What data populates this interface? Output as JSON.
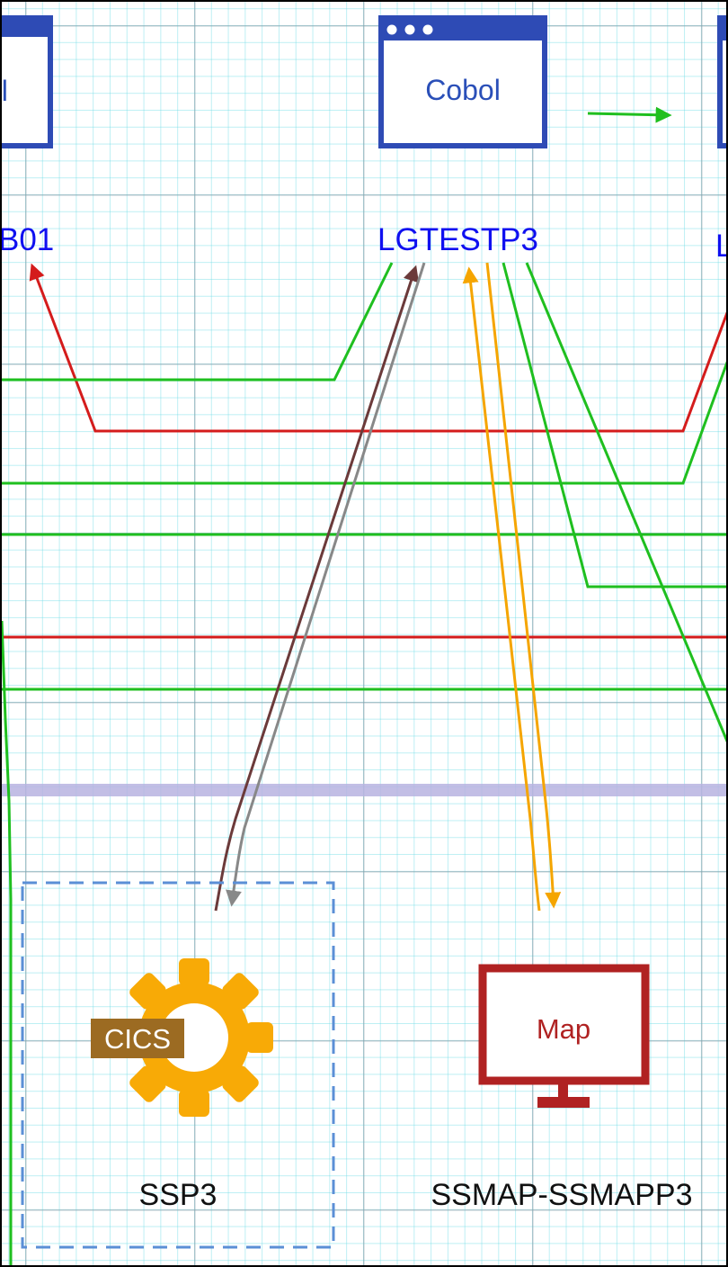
{
  "windows": {
    "left_partial_title": "ol",
    "center_title": "Cobol"
  },
  "programs": {
    "left_partial": "B01",
    "center": "LGTESTP3",
    "right_partial": "L"
  },
  "nodes": {
    "cics_badge": "CICS",
    "cics_name": "SSP3",
    "map_screen": "Map",
    "map_name": "SSMAP-SSMAPP3"
  },
  "colors": {
    "window_blue": "#2e4bb5",
    "program_blue": "#1010f0",
    "flow_green": "#1fbf1f",
    "flow_red": "#d41c1c",
    "cics_arrow": "#6b3a3a",
    "return_arrow": "#888888",
    "map_arrow": "#f5a500",
    "gear": "#f8aa06",
    "cics_badge": "#9c6b22",
    "map_red": "#b02222",
    "lane_divider": "#b7b3e0",
    "group_border": "#5b8fd6"
  },
  "icons": [
    "window-icon",
    "gear-icon",
    "monitor-icon"
  ]
}
